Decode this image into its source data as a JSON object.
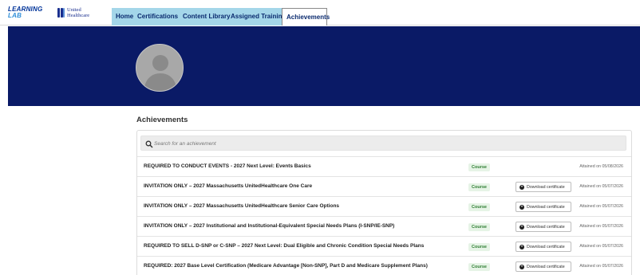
{
  "brand": {
    "learning_lab_line1": "LEARNING",
    "learning_lab_line2": "LAB",
    "uhc_line1": "United",
    "uhc_line2": "Healthcare",
    "colors": {
      "navy": "#0a1a66",
      "nav_strip": "#a4d6e9",
      "nav_text": "#0a2a6e"
    }
  },
  "nav": {
    "tabs": [
      {
        "label": "Home"
      },
      {
        "label": "Certifications"
      },
      {
        "label": "Content Library"
      },
      {
        "label": "Assigned Training"
      },
      {
        "label": "Achievements",
        "active": true
      }
    ]
  },
  "profile": {
    "avatar_icon": "user-silhouette-icon"
  },
  "achievements": {
    "heading": "Achievements",
    "search_placeholder": "Search for an achievement",
    "download_label": "Download certificate",
    "rows": [
      {
        "title": "REQUIRED TO CONDUCT EVENTS - 2027 Next Level: Events Basics",
        "type": "Course",
        "download": false,
        "attained": "Attained on 05/08/2026"
      },
      {
        "title": "INVITATION ONLY – 2027 Massachusetts UnitedHealthcare One Care",
        "type": "Course",
        "download": true,
        "attained": "Attained on 05/07/2026"
      },
      {
        "title": "INVITATION ONLY – 2027 Massachusetts UnitedHealthcare Senior Care Options",
        "type": "Course",
        "download": true,
        "attained": "Attained on 05/07/2026"
      },
      {
        "title": "INVITATION ONLY – 2027 Institutional and Institutional-Equivalent Special Needs Plans (I-SNP/IE-SNP)",
        "type": "Course",
        "download": true,
        "attained": "Attained on 05/07/2026"
      },
      {
        "title": "REQUIRED TO SELL D-SNP or C-SNP – 2027 Next Level: Dual Eligible and Chronic Condition Special Needs Plans",
        "type": "Course",
        "download": true,
        "attained": "Attained on 05/07/2026"
      },
      {
        "title": "REQUIRED: 2027 Base Level Certification (Medicare Advantage [Non-SNP], Part D and Medicare Supplement Plans)",
        "type": "Course",
        "download": true,
        "attained": "Attained on 05/07/2026"
      }
    ]
  }
}
